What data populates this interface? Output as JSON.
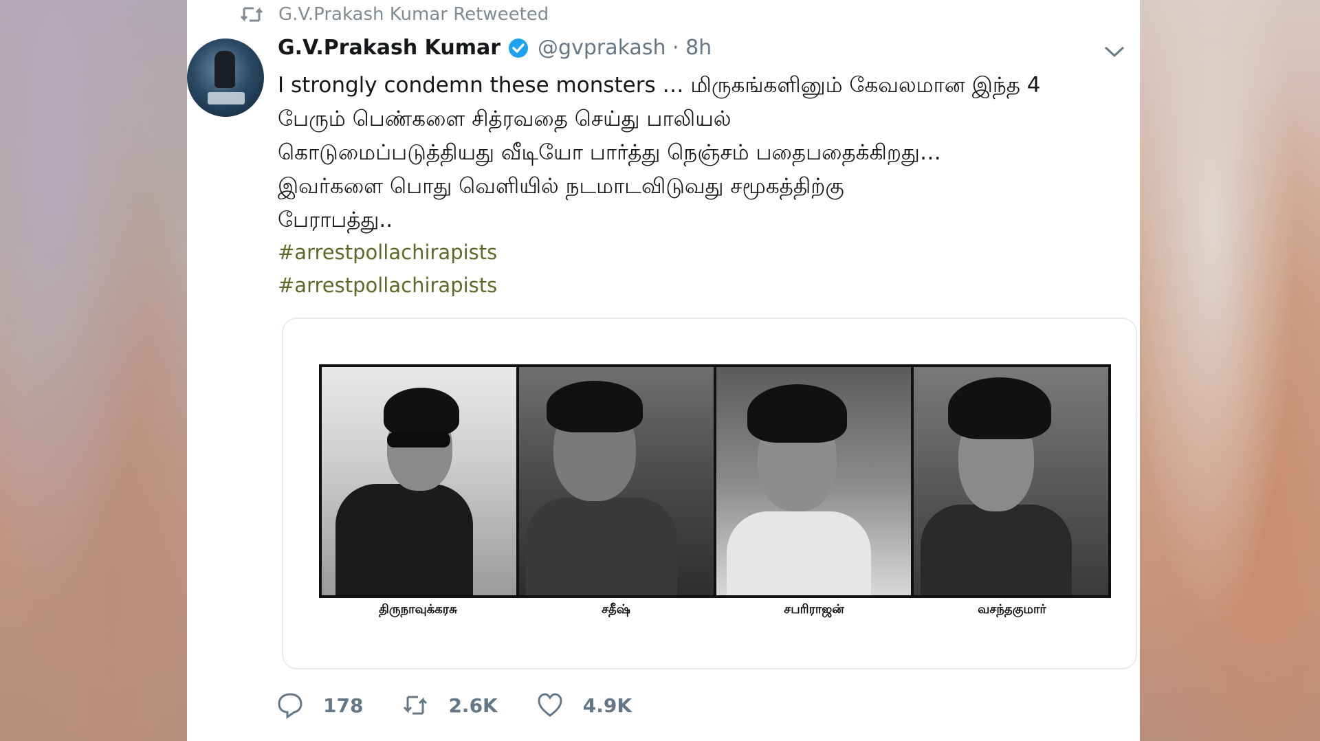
{
  "retweet_banner": {
    "text": "G.V.Prakash Kumar Retweeted"
  },
  "author": {
    "name": "G.V.Prakash Kumar",
    "handle": "@gvprakash · 8h"
  },
  "tweet": {
    "lines": [
      "I strongly condemn these monsters … மிருகங்களினும் கேவலமான இந்த 4",
      "பேரும் பெண்களை சித்ரவதை செய்து பாலியல்",
      "கொடுமைப்படுத்தியது வீடியோ பார்த்து நெஞ்சம் பதைபதைக்கிறது…",
      "இவர்களை பொது வெளியில் நடமாடவிடுவது சமூகத்திற்கு",
      "பேராபத்து.."
    ],
    "hashtags": [
      "#arrestpollachirapists",
      "#arrestpollachirapists"
    ]
  },
  "media": {
    "captions": [
      "திருநாவுக்கரசு",
      "சதீஷ்",
      "சபரிராஜன்",
      "வசந்தகுமார்"
    ]
  },
  "actions": {
    "replies": "178",
    "retweets": "2.6K",
    "likes": "4.9K"
  },
  "colors": {
    "verified": "#1da1f2",
    "hashtag": "#5b6a2a",
    "muted": "#657786"
  }
}
